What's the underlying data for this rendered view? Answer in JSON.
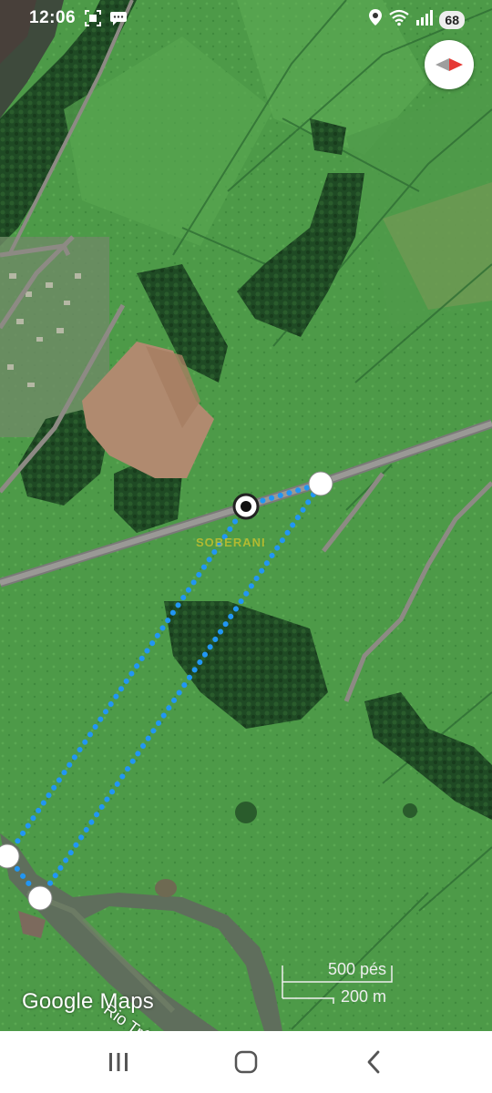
{
  "status_bar": {
    "time": "12:06",
    "battery": "68",
    "left_icons": [
      "screenshot-icon",
      "message-icon"
    ],
    "right_icons": [
      "location-icon",
      "wifi-icon",
      "signal-icon"
    ]
  },
  "map": {
    "provider_logo": "Google Maps",
    "scale_feet": "500 pés",
    "scale_meters": "200 m",
    "river_label": "Rio Três B",
    "watermark": "SOBERANI",
    "route_color": "#2196f3",
    "compass_icon": "compass-needle-icon"
  },
  "nav_bar": {
    "recent": "recent-apps-icon",
    "home": "home-icon",
    "back": "back-icon"
  }
}
